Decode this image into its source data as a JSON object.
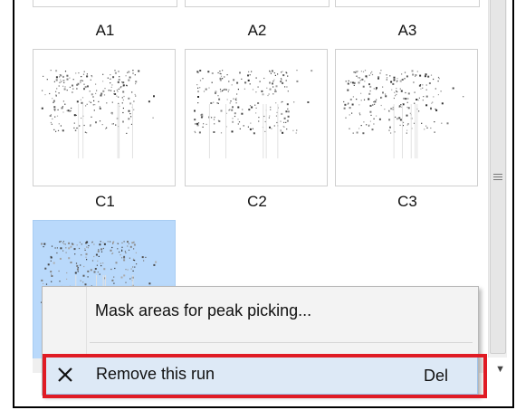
{
  "thumbnails": {
    "row1_labels": [
      "A1",
      "A2",
      "A3"
    ],
    "row2_labels": [
      "C1",
      "C2",
      "C3"
    ]
  },
  "context_menu": {
    "items": [
      {
        "label": "Mask areas for peak picking...",
        "shortcut": "",
        "icon": "none"
      },
      {
        "label": "Remove this run",
        "shortcut": "Del",
        "icon": "x-close-icon"
      }
    ]
  },
  "colors": {
    "selection": "#b9d9fb",
    "menu_hover": "#dde9f6",
    "highlight_border": "#e01b24"
  }
}
